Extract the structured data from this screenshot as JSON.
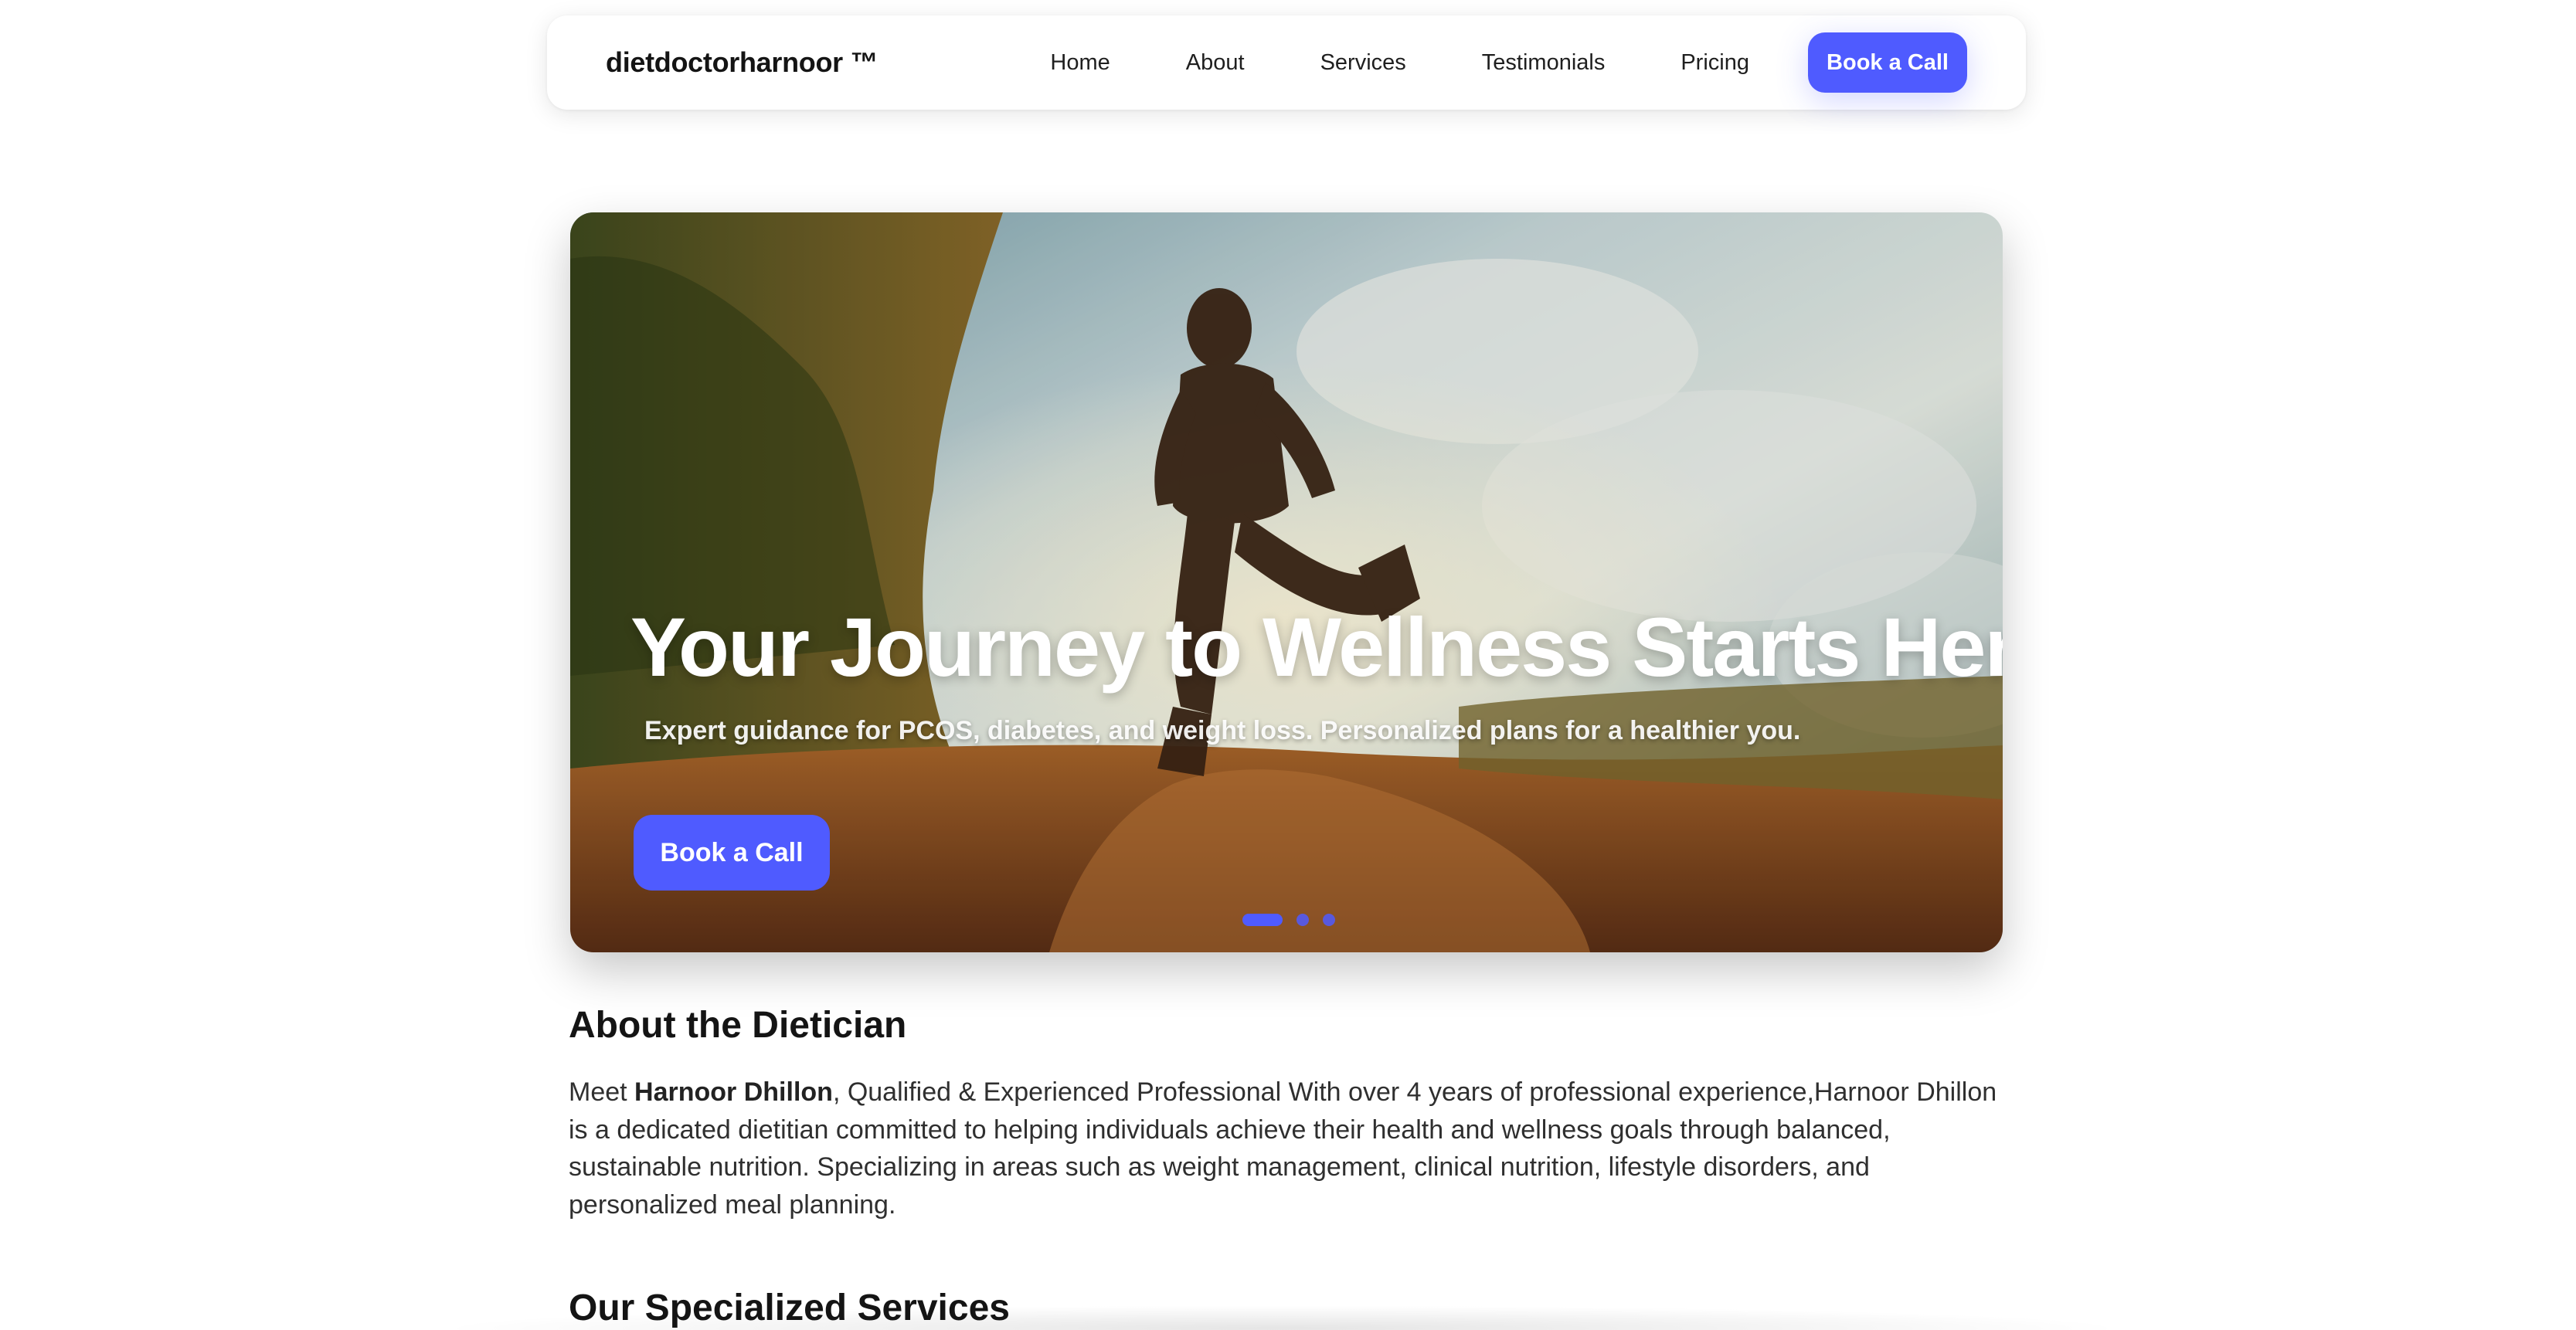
{
  "header": {
    "brand": "dietdoctorharnoor ™",
    "nav": [
      {
        "label": "Home"
      },
      {
        "label": "About"
      },
      {
        "label": "Services"
      },
      {
        "label": "Testimonials"
      },
      {
        "label": "Pricing"
      }
    ],
    "cta_label": "Book a Call"
  },
  "hero": {
    "title": "Your Journey to Wellness Starts Here",
    "subtitle": "Expert guidance for PCOS, diabetes, and weight loss. Personalized plans for a healthier you.",
    "cta_label": "Book a Call",
    "slides_total": 3,
    "active_slide": 1
  },
  "about": {
    "heading": "About the Dietician",
    "text_prefix": "Meet ",
    "name": "Harnoor Dhillon",
    "text_rest": ", Qualified & Experienced Professional With over 4 years of professional experience,Harnoor Dhillon is a dedicated dietitian committed to helping individuals achieve their health and wellness goals through balanced, sustainable nutrition. Specializing in areas such as weight management, clinical nutrition, lifestyle disorders, and personalized meal planning."
  },
  "services": {
    "heading": "Our Specialized Services"
  },
  "colors": {
    "accent": "#4f5bff"
  }
}
